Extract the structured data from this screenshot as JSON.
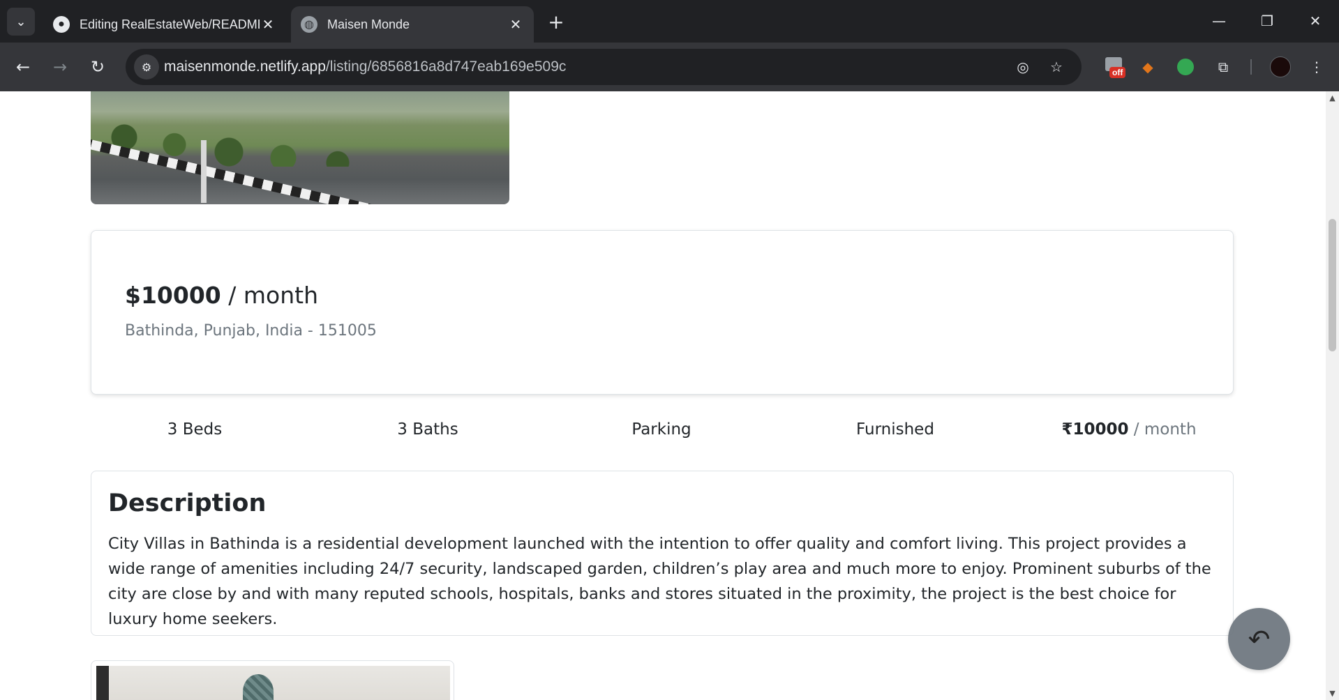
{
  "browser": {
    "tabs": [
      {
        "title": "Editing RealEstateWeb/README",
        "icon": "github-icon",
        "active": false
      },
      {
        "title": "Maisen Monde",
        "icon": "globe-icon",
        "active": true
      }
    ],
    "url_host": "maisenmonde.netlify.app",
    "url_path": "/listing/6856816a8d747eab169e509c",
    "extension_badge": "off"
  },
  "listing": {
    "price": "$10000",
    "price_unit": " / month",
    "address": "Bathinda, Punjab, India - 151005",
    "features": {
      "beds": "3 Beds",
      "baths": "3 Baths",
      "parking": "Parking",
      "furnished": "Furnished",
      "rent_amount": "₹10000",
      "rent_unit": " / month"
    },
    "description_title": "Description",
    "description": "City Villas in Bathinda is a residential development launched with the intention to offer quality and comfort living. This project provides a wide range of amenities including 24/7 security, landscaped garden, children’s play area and much more to enjoy. Prominent suburbs of the city are close by and with many reputed schools, hospitals, banks and stores situated in the proximity, the project is the best choice for luxury home seekers."
  },
  "icons": {
    "fab": "undo-icon"
  }
}
